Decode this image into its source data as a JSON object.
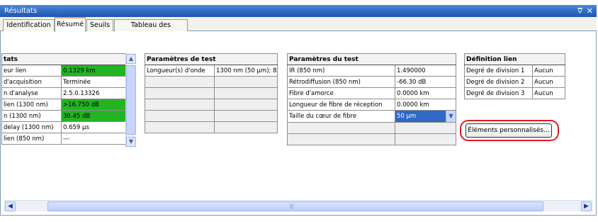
{
  "window": {
    "title": "Résultats",
    "pin_glyph": "⩢",
    "close_glyph": "✕"
  },
  "tabs": [
    {
      "label": "Identification",
      "active": false
    },
    {
      "label": "Résumé",
      "active": true
    },
    {
      "label": "Seuils",
      "active": false
    },
    {
      "label": "Tableau des éléments",
      "active": false
    }
  ],
  "status_table": {
    "header": "tats",
    "rows": [
      {
        "label": "eur lien",
        "value": "0.1329 km",
        "status": "pass"
      },
      {
        "label": "d'acquisition",
        "value": "Terminée",
        "status": ""
      },
      {
        "label": "n d'analyse",
        "value": "2.5.0.13326",
        "status": ""
      },
      {
        "label": "lien (1300 nm)",
        "value": ">16.750 dB",
        "status": "pass"
      },
      {
        "label": "n (1300 nm)",
        "value": "30.45 dB",
        "status": "pass"
      },
      {
        "label": "delay (1300 nm)",
        "value": "0.659 µs",
        "status": ""
      },
      {
        "label": "lien (850 nm)",
        "value": "---",
        "status": ""
      }
    ]
  },
  "test_params_left": {
    "header": "Paramètres de test",
    "rows": [
      {
        "label": "Longueur(s) d'onde",
        "value": "1300 nm (50 µm); 8"
      }
    ]
  },
  "test_params_mid": {
    "header": "Paramètres du test",
    "rows": [
      {
        "label": "IR (850 nm)",
        "value": "1.490000"
      },
      {
        "label": "Rétrodiffusion (850 nm)",
        "value": "-66.30 dB"
      },
      {
        "label": "Fibre d'amorce",
        "value": "0.0000 km"
      },
      {
        "label": "Longueur de fibre de réception",
        "value": "0.0000 km"
      },
      {
        "label": "Taille du cœur de fibre",
        "value": "50 µm"
      }
    ]
  },
  "link_definition": {
    "header": "Définition lien",
    "rows": [
      {
        "label": "Degré de division 1",
        "value": "Aucun"
      },
      {
        "label": "Degré de division 2",
        "value": "Aucun"
      },
      {
        "label": "Degré de division 3",
        "value": "Aucun"
      }
    ]
  },
  "custom_elements_button": {
    "label": "Éléments personnalisés..."
  },
  "scroll_glyphs": {
    "up": "▲",
    "down": "▼",
    "left": "◀",
    "right": "▶",
    "grip": "||||"
  },
  "colors": {
    "pass": "#22b422",
    "title_bar": "#2e69c2",
    "highlight": "#e11b22",
    "selection": "#3168c6"
  }
}
